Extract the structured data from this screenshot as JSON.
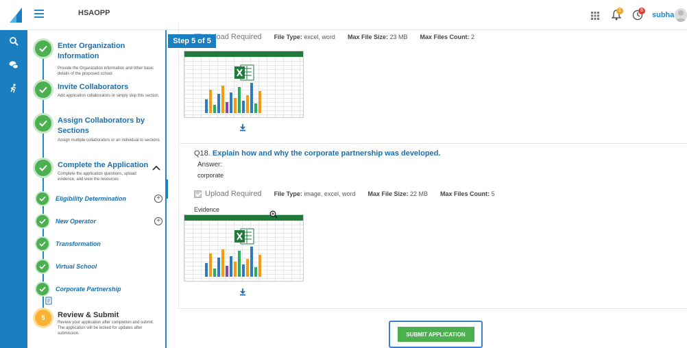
{
  "app": {
    "title": "HSAOPP",
    "username": "subha",
    "notifications_badge": "1",
    "alerts_badge": "8",
    "accent_color": "#1a7fc1"
  },
  "steps": [
    {
      "title": "Enter Organization Information",
      "desc": "Provide the Organization information and other basic details of the proposed school",
      "status": "complete"
    },
    {
      "title": "Invite Collaborators",
      "desc": "Add application collaborators or simply skip this section.",
      "status": "complete"
    },
    {
      "title": "Assign Collaborators by Sections",
      "desc": "Assign multiple collaborators or an individual to sections",
      "status": "complete"
    },
    {
      "title": "Complete the Application",
      "desc": "Complete the application questions, upload evidence, and view the resources",
      "status": "complete"
    },
    {
      "title": "Review & Submit",
      "desc": "Review your application after completion and submit. The application will be locked for updates after submission.",
      "status": "current",
      "number": "5"
    }
  ],
  "substeps": [
    {
      "label": "Eligibility Determination",
      "expandable": true
    },
    {
      "label": "New Operator",
      "expandable": true
    },
    {
      "label": "Transformation",
      "expandable": false
    },
    {
      "label": "Virtual School",
      "expandable": false
    },
    {
      "label": "Corporate Partnership",
      "expandable": false
    }
  ],
  "main": {
    "step_badge": "Step 5 of 5",
    "upload_required_label": "Upload Required",
    "file_type_label": "File Type:",
    "max_size_label": "Max File Size:",
    "max_count_label": "Max Files Count:",
    "block1": {
      "file_types": "excel, word",
      "max_size": "23 MB",
      "max_count": "2"
    },
    "q18": {
      "number": "Q18.",
      "question": "Explain how and why the corporate partnership was developed.",
      "answer_label": "Answer:",
      "answer_value": "corporate",
      "file_types": "image, excel, word",
      "max_size": "22 MB",
      "max_count": "5",
      "evidence_label": "Evidence"
    },
    "submit_label": "SUBMIT APPLICATION"
  }
}
